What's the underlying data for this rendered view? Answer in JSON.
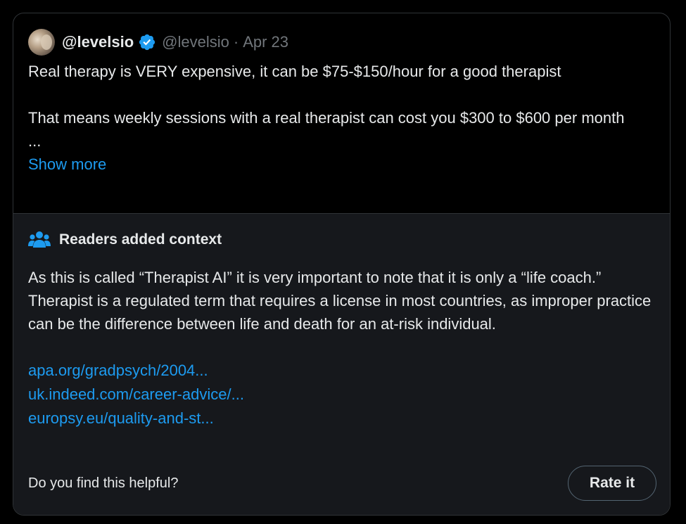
{
  "tweet": {
    "display_name": "@levelsio",
    "handle": "@levelsio",
    "separator": "·",
    "date": "Apr 23",
    "lines": [
      "Real therapy is VERY expensive, it can be $75-$150/hour for a good therapist",
      "That means weekly sessions with a real therapist can cost you $300 to $600 per month",
      "..."
    ],
    "show_more": "Show more"
  },
  "context": {
    "icon": "people-icon",
    "title": "Readers added context",
    "body": "As this is called “Therapist AI” it is very important to note that it is only a “life coach.” Therapist is a regulated term that requires a license in most countries, as improper practice can be the difference between life and death for an at-risk individual.",
    "links": [
      "apa.org/gradpsych/2004...",
      "uk.indeed.com/career-advice/...",
      "europsy.eu/quality-and-st..."
    ],
    "helpful_question": "Do you find this helpful?",
    "rate_button": "Rate it"
  },
  "colors": {
    "background": "#000000",
    "context_background": "#16181c",
    "text": "#e7e9ea",
    "muted": "#71767b",
    "link": "#1d9bf0",
    "verified": "#1d9bf0"
  }
}
